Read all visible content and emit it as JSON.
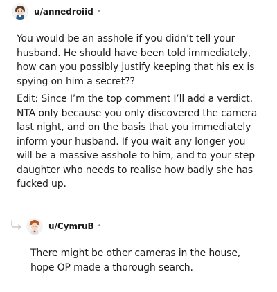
{
  "comments": [
    {
      "username": "u/annedroiid",
      "separator": "•",
      "paragraphs": [
        "You would be an asshole if you didn’t tell your\nhusband. He should have been told immediately,\nhow can you possibly justify keeping that his ex is\nspying on him a secret??",
        "Edit: Since I’m the top comment I’ll add a verdict.\nNTA only because you only discovered the camera\nlast night, and on the basis that you immediately\ninform your husband. If you wait any longer you\nwill be a massive asshole to him, and to your step\ndaughter who needs to realise how badly she has\nfucked up."
      ]
    },
    {
      "username": "u/CymruB",
      "separator": "•",
      "paragraphs": [
        "There might be other cameras in the house,\nhope OP made a thorough search."
      ]
    }
  ],
  "icons": {
    "avatar_1": "user-avatar-icon",
    "avatar_2": "user-avatar-icon",
    "reply_indicator": "reply-arrow-icon"
  },
  "colors": {
    "text": "#1c1c1c",
    "meta": "#878a8c",
    "thread_line": "#c7cacc"
  }
}
